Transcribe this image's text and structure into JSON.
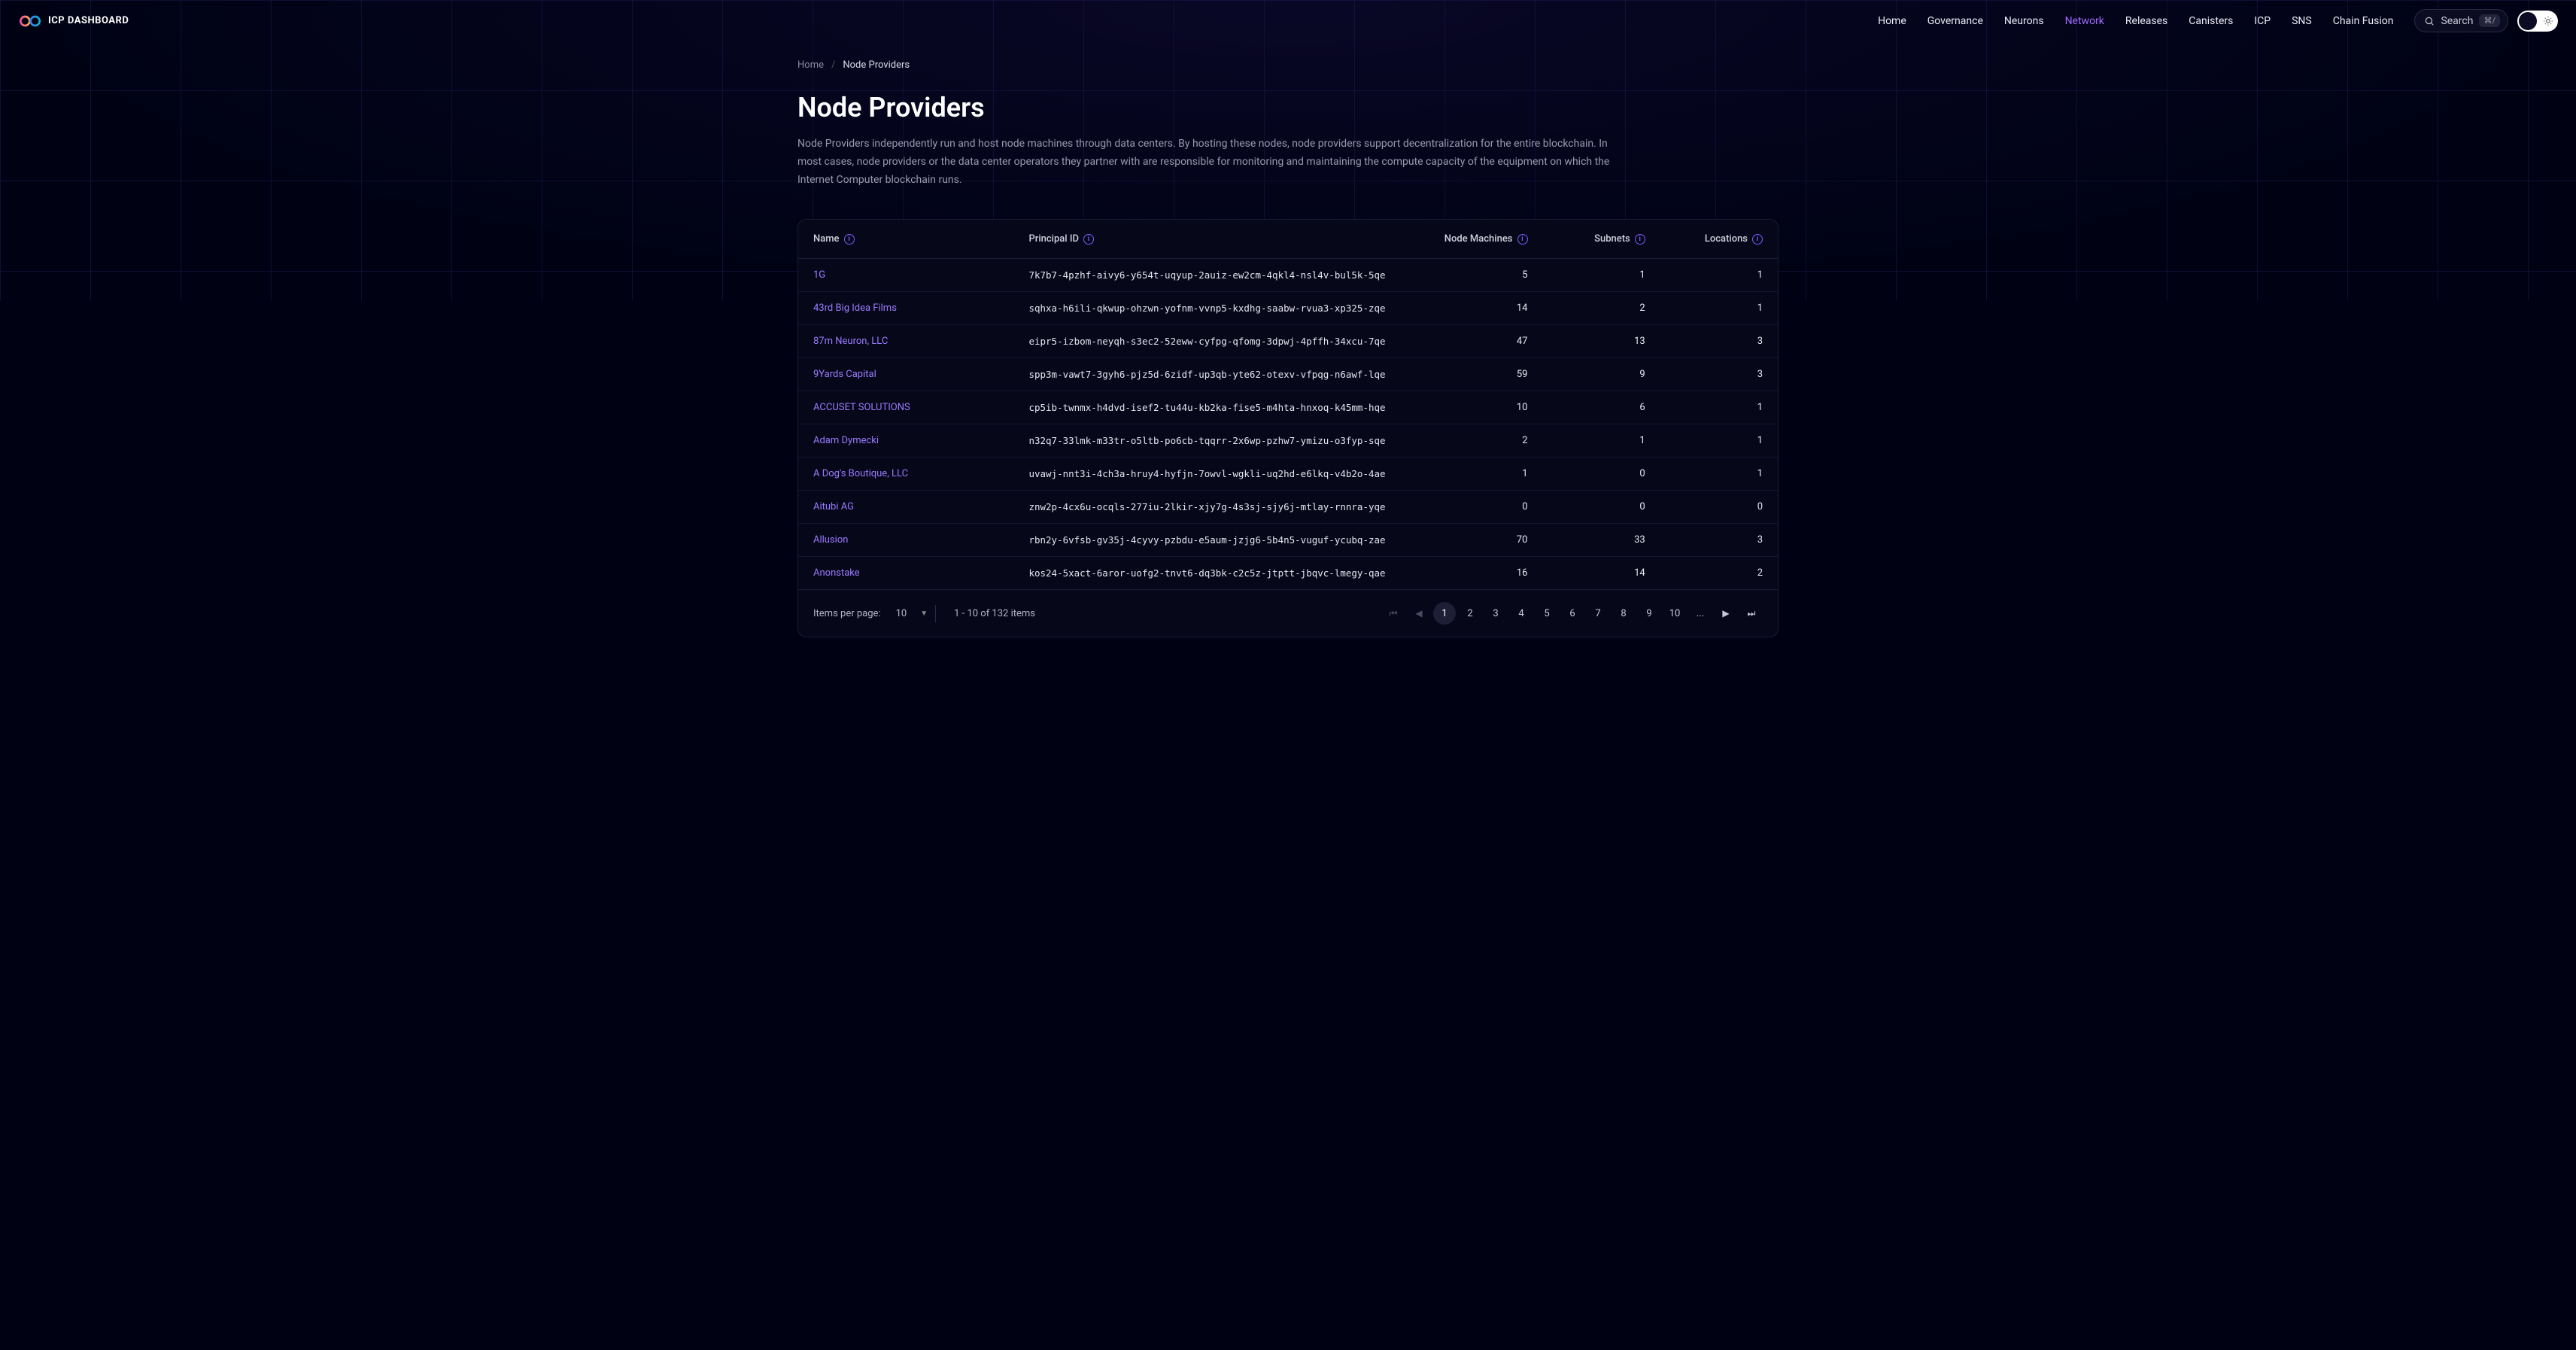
{
  "brand": "ICP DASHBOARD",
  "nav": {
    "items": [
      {
        "label": "Home",
        "active": false
      },
      {
        "label": "Governance",
        "active": false
      },
      {
        "label": "Neurons",
        "active": false
      },
      {
        "label": "Network",
        "active": true
      },
      {
        "label": "Releases",
        "active": false
      },
      {
        "label": "Canisters",
        "active": false
      },
      {
        "label": "ICP",
        "active": false
      },
      {
        "label": "SNS",
        "active": false
      },
      {
        "label": "Chain Fusion",
        "active": false
      }
    ],
    "search_label": "Search",
    "search_kbd": "⌘/"
  },
  "breadcrumb": {
    "home": "Home",
    "current": "Node Providers"
  },
  "page": {
    "title": "Node Providers",
    "description": "Node Providers independently run and host node machines through data centers. By hosting these nodes, node providers support decentralization for the entire blockchain. In most cases, node providers or the data center operators they partner with are responsible for monitoring and maintaining the compute capacity of the equipment on which the Internet Computer blockchain runs."
  },
  "table": {
    "headers": {
      "name": "Name",
      "principal": "Principal ID",
      "machines": "Node Machines",
      "subnets": "Subnets",
      "locations": "Locations"
    },
    "rows": [
      {
        "name": "1G",
        "principal": "7k7b7-4pzhf-aivy6-y654t-uqyup-2auiz-ew2cm-4qkl4-nsl4v-bul5k-5qe",
        "machines": "5",
        "subnets": "1",
        "locations": "1"
      },
      {
        "name": "43rd Big Idea Films",
        "principal": "sqhxa-h6ili-qkwup-ohzwn-yofnm-vvnp5-kxdhg-saabw-rvua3-xp325-zqe",
        "machines": "14",
        "subnets": "2",
        "locations": "1"
      },
      {
        "name": "87m Neuron, LLC",
        "principal": "eipr5-izbom-neyqh-s3ec2-52eww-cyfpg-qfomg-3dpwj-4pffh-34xcu-7qe",
        "machines": "47",
        "subnets": "13",
        "locations": "3"
      },
      {
        "name": "9Yards Capital",
        "principal": "spp3m-vawt7-3gyh6-pjz5d-6zidf-up3qb-yte62-otexv-vfpqg-n6awf-lqe",
        "machines": "59",
        "subnets": "9",
        "locations": "3"
      },
      {
        "name": "ACCUSET SOLUTIONS",
        "principal": "cp5ib-twnmx-h4dvd-isef2-tu44u-kb2ka-fise5-m4hta-hnxoq-k45mm-hqe",
        "machines": "10",
        "subnets": "6",
        "locations": "1"
      },
      {
        "name": "Adam Dymecki",
        "principal": "n32q7-33lmk-m33tr-o5ltb-po6cb-tqqrr-2x6wp-pzhw7-ymizu-o3fyp-sqe",
        "machines": "2",
        "subnets": "1",
        "locations": "1"
      },
      {
        "name": "A Dog's Boutique, LLC",
        "principal": "uvawj-nnt3i-4ch3a-hruy4-hyfjn-7owvl-wgkli-uq2hd-e6lkq-v4b2o-4ae",
        "machines": "1",
        "subnets": "0",
        "locations": "1"
      },
      {
        "name": "Aitubi AG",
        "principal": "znw2p-4cx6u-ocqls-277iu-2lkir-xjy7g-4s3sj-sjy6j-mtlay-rnnra-yqe",
        "machines": "0",
        "subnets": "0",
        "locations": "0"
      },
      {
        "name": "Allusion",
        "principal": "rbn2y-6vfsb-gv35j-4cyvy-pzbdu-e5aum-jzjg6-5b4n5-vuguf-ycubq-zae",
        "machines": "70",
        "subnets": "33",
        "locations": "3"
      },
      {
        "name": "Anonstake",
        "principal": "kos24-5xact-6aror-uofg2-tnvt6-dq3bk-c2c5z-jtptt-jbqvc-lmegy-qae",
        "machines": "16",
        "subnets": "14",
        "locations": "2"
      }
    ]
  },
  "footer": {
    "ipp_label": "Items per page:",
    "ipp_value": "10",
    "range": "1 - 10 of 132 items",
    "pages": [
      "1",
      "2",
      "3",
      "4",
      "5",
      "6",
      "7",
      "8",
      "9",
      "10",
      "..."
    ],
    "current_page": "1"
  }
}
